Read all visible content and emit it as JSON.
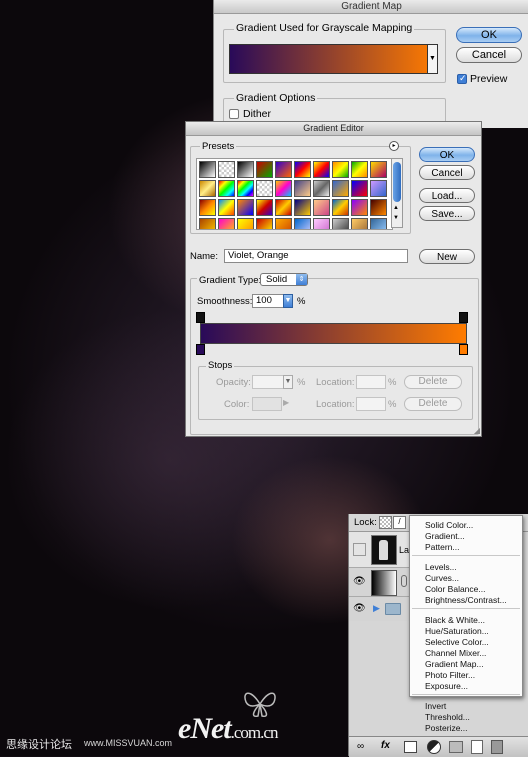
{
  "gradient_map": {
    "title": "Gradient Map",
    "group_gradient": "Gradient Used for Grayscale Mapping",
    "group_options": "Gradient Options",
    "dither_label": "Dither",
    "ok_label": "OK",
    "cancel_label": "Cancel",
    "preview_label": "Preview",
    "preview_checked": true
  },
  "gradient_editor": {
    "title": "Gradient Editor",
    "presets_label": "Presets",
    "ok_label": "OK",
    "cancel_label": "Cancel",
    "load_label": "Load...",
    "save_label": "Save...",
    "name_label": "Name:",
    "name_value": "Violet, Orange",
    "new_label": "New",
    "gradient_type_label": "Gradient Type:",
    "gradient_type_value": "Solid",
    "smoothness_label": "Smoothness:",
    "smoothness_value": "100",
    "percent": "%",
    "stops_label": "Stops",
    "opacity_label": "Opacity:",
    "color_label": "Color:",
    "location_label": "Location:",
    "delete_label": "Delete",
    "colors": {
      "start": "#290a59",
      "end": "#ff7c00"
    }
  },
  "layers_panel": {
    "lock_label": "Lock:",
    "layer_label": "Lay",
    "fx_label": "fx"
  },
  "adjustment_menu": {
    "items_group1": [
      "Solid Color...",
      "Gradient...",
      "Pattern..."
    ],
    "items_group2": [
      "Levels...",
      "Curves...",
      "Color Balance...",
      "Brightness/Contrast..."
    ],
    "items_group3": [
      "Black & White...",
      "Hue/Saturation...",
      "Selective Color...",
      "Channel Mixer...",
      "Gradient Map...",
      "Photo Filter...",
      "Exposure..."
    ],
    "items_group4": [
      "Invert",
      "Threshold...",
      "Posterize..."
    ]
  },
  "watermark": {
    "left_text": "思缘设计论坛",
    "left_url": "www.MISSVUAN.com",
    "brand": "eNet",
    "brand_suffix": ".com.cn"
  }
}
